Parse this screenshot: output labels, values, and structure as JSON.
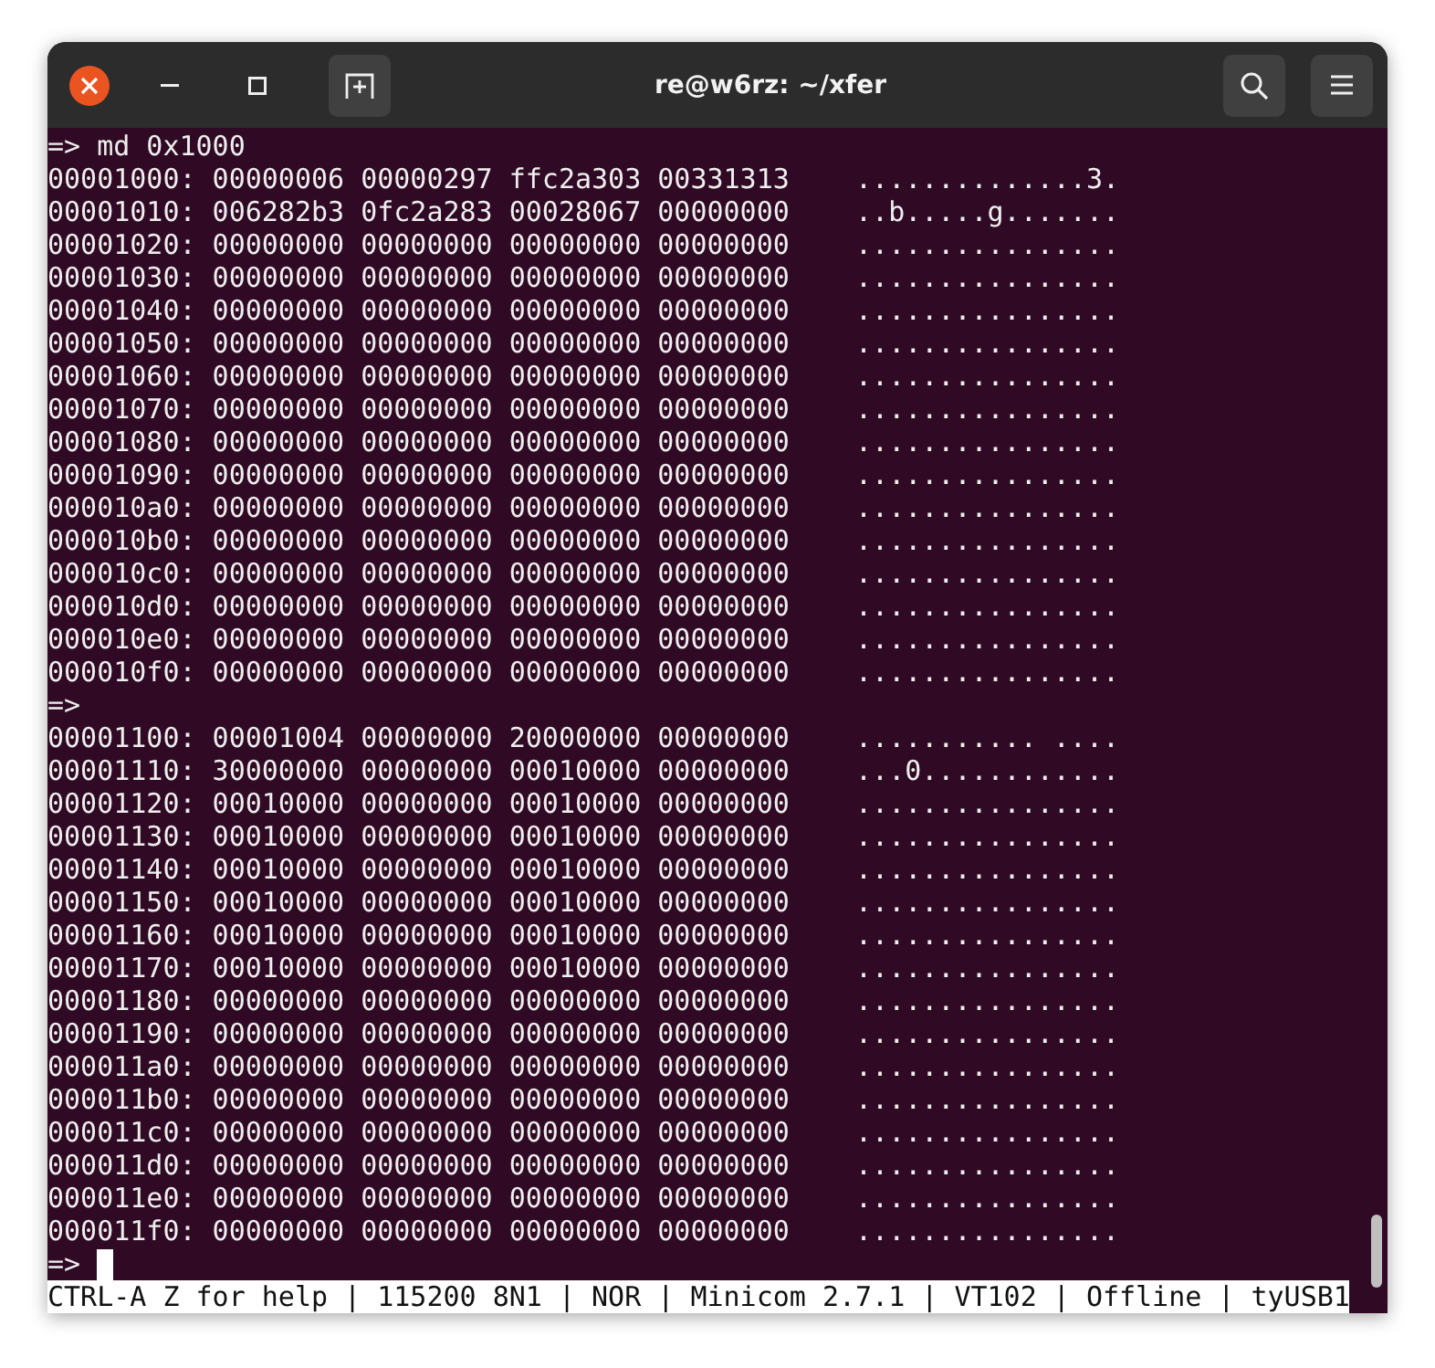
{
  "window": {
    "title": "re@w6rz: ~/xfer"
  },
  "lines": [
    "=> md 0x1000",
    "00001000: 00000006 00000297 ffc2a303 00331313    ..............3.",
    "00001010: 006282b3 0fc2a283 00028067 00000000    ..b.....g.......",
    "00001020: 00000000 00000000 00000000 00000000    ................",
    "00001030: 00000000 00000000 00000000 00000000    ................",
    "00001040: 00000000 00000000 00000000 00000000    ................",
    "00001050: 00000000 00000000 00000000 00000000    ................",
    "00001060: 00000000 00000000 00000000 00000000    ................",
    "00001070: 00000000 00000000 00000000 00000000    ................",
    "00001080: 00000000 00000000 00000000 00000000    ................",
    "00001090: 00000000 00000000 00000000 00000000    ................",
    "000010a0: 00000000 00000000 00000000 00000000    ................",
    "000010b0: 00000000 00000000 00000000 00000000    ................",
    "000010c0: 00000000 00000000 00000000 00000000    ................",
    "000010d0: 00000000 00000000 00000000 00000000    ................",
    "000010e0: 00000000 00000000 00000000 00000000    ................",
    "000010f0: 00000000 00000000 00000000 00000000    ................",
    "=>",
    "00001100: 00001004 00000000 20000000 00000000    ........... ....",
    "00001110: 30000000 00000000 00010000 00000000    ...0............",
    "00001120: 00010000 00000000 00010000 00000000    ................",
    "00001130: 00010000 00000000 00010000 00000000    ................",
    "00001140: 00010000 00000000 00010000 00000000    ................",
    "00001150: 00010000 00000000 00010000 00000000    ................",
    "00001160: 00010000 00000000 00010000 00000000    ................",
    "00001170: 00010000 00000000 00010000 00000000    ................",
    "00001180: 00000000 00000000 00000000 00000000    ................",
    "00001190: 00000000 00000000 00000000 00000000    ................",
    "000011a0: 00000000 00000000 00000000 00000000    ................",
    "000011b0: 00000000 00000000 00000000 00000000    ................",
    "000011c0: 00000000 00000000 00000000 00000000    ................",
    "000011d0: 00000000 00000000 00000000 00000000    ................",
    "000011e0: 00000000 00000000 00000000 00000000    ................",
    "000011f0: 00000000 00000000 00000000 00000000    ................"
  ],
  "prompt": {
    "text": "=>",
    "cursor": true
  },
  "status_line": "CTRL-A Z for help | 115200 8N1 | NOR | Minicom 2.7.1 | VT102 | Offline | tyUSB1"
}
